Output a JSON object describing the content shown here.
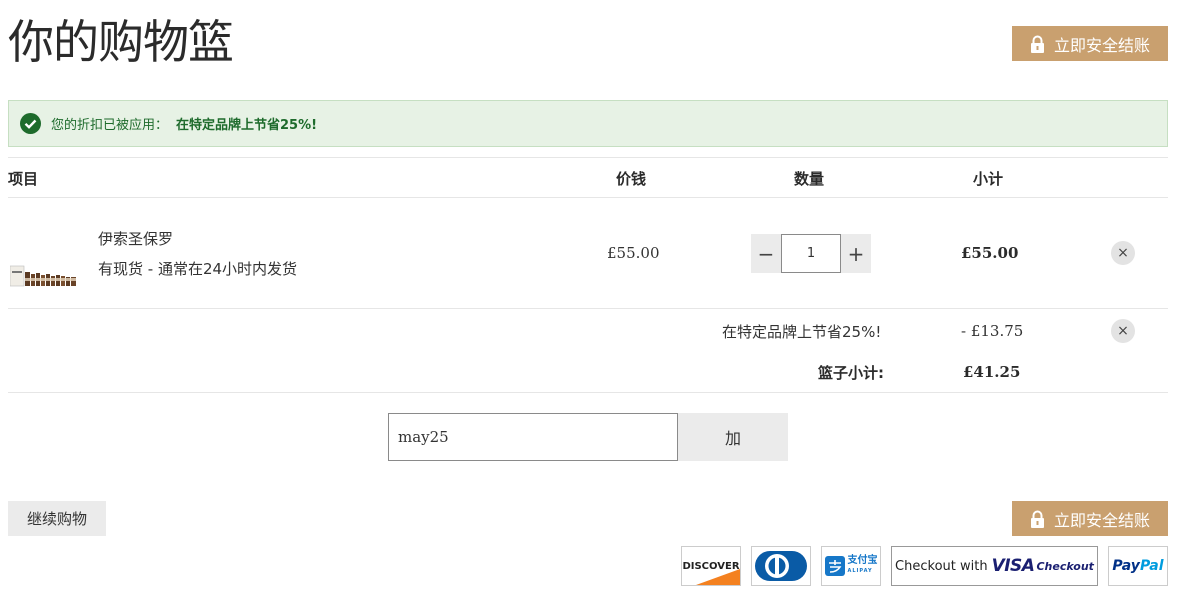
{
  "page_title": "你的购物篮",
  "checkout_label": "立即安全结账",
  "alert": {
    "text": "您的折扣已被应用：",
    "strong": "在特定品牌上节省25%!"
  },
  "table_headers": {
    "item": "项目",
    "price": "价钱",
    "quantity": "数量",
    "subtotal": "小计"
  },
  "item": {
    "name": "伊索圣保罗",
    "stock": "有现货 - 通常在24小时内发货",
    "price": "£55.00",
    "quantity": "1",
    "subtotal": "£55.00",
    "qty_minus": "−",
    "qty_plus": "+",
    "remove": "×"
  },
  "discount": {
    "label": "在特定品牌上节省25%!",
    "value": "- £13.75",
    "remove": "×"
  },
  "basket": {
    "label": "篮子小计:",
    "value": "£41.25"
  },
  "promo": {
    "code_value": "may25",
    "apply_label": "加"
  },
  "continue_label": "继续购物",
  "payments": {
    "discover": "DISCOVER",
    "alipay": "支付宝",
    "alipay_sub": "ALIPAY",
    "visa_prefix": "Checkout with",
    "visa_word": "VISA",
    "visa_suffix": "Checkout",
    "paypal_a": "Pay",
    "paypal_b": "Pal"
  },
  "colors": {
    "checkout_button": "#c9a06f",
    "alert_background": "#e7f2e5",
    "alert_text": "#1e6b2c",
    "discover_orange": "#f48120",
    "diners_blue": "#0a5ba6",
    "visa_blue": "#1a1f71",
    "paypal_dark": "#003087",
    "paypal_light": "#009cde"
  },
  "icons": {
    "checkout": "lock-icon",
    "alert": "check-circle-icon",
    "remove": "close-icon"
  }
}
